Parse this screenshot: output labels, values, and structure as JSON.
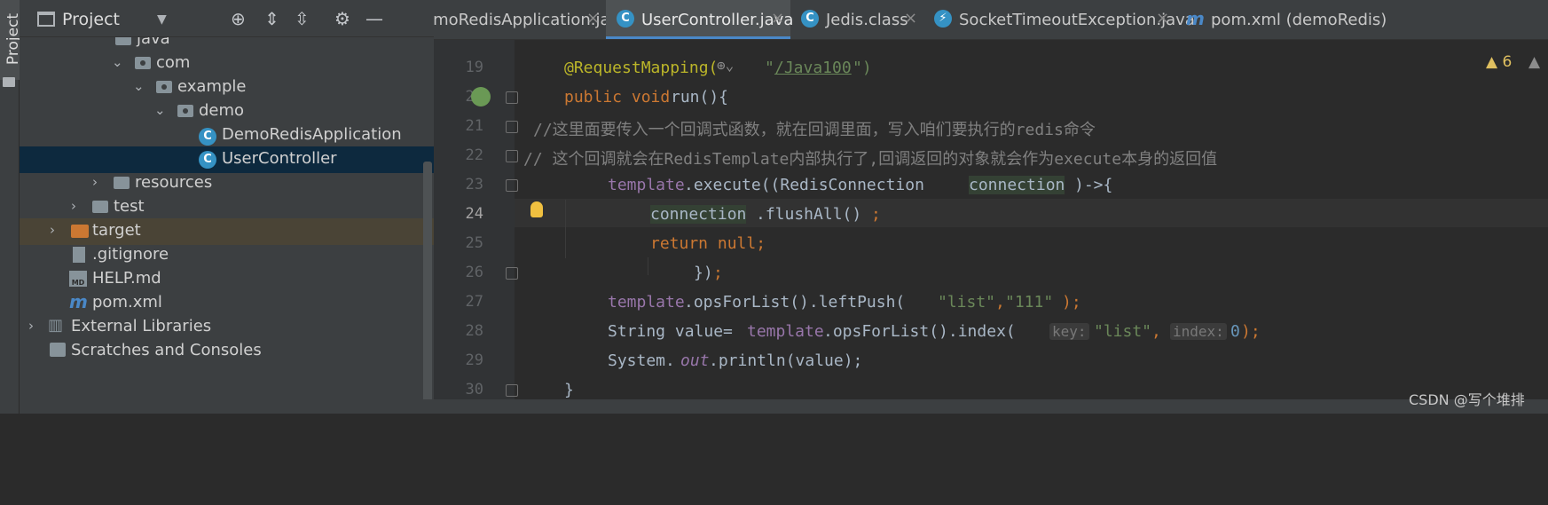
{
  "side_strip": {
    "label": "Project"
  },
  "project_panel": {
    "title": "Project",
    "tree": [
      {
        "label": "java",
        "level": 5,
        "kind": "folder",
        "expanded": true
      },
      {
        "label": "com",
        "level": 5,
        "kind": "package",
        "expanded": true
      },
      {
        "label": "example",
        "level": 6,
        "kind": "package",
        "expanded": true
      },
      {
        "label": "demo",
        "level": 7,
        "kind": "package",
        "expanded": true
      },
      {
        "label": "DemoRedisApplication",
        "level": 8,
        "kind": "spring-class"
      },
      {
        "label": "UserController",
        "level": 8,
        "kind": "class",
        "selected": true
      },
      {
        "label": "resources",
        "level": 4,
        "kind": "folder",
        "expanded": false
      },
      {
        "label": "test",
        "level": 3,
        "kind": "folder",
        "expanded": false
      },
      {
        "label": "target",
        "level": 2,
        "kind": "excluded-folder",
        "expanded": false
      },
      {
        "label": ".gitignore",
        "level": 2,
        "kind": "file"
      },
      {
        "label": "HELP.md",
        "level": 2,
        "kind": "md-file"
      },
      {
        "label": "pom.xml",
        "level": 2,
        "kind": "maven-file"
      },
      {
        "label": "External Libraries",
        "level": 1,
        "kind": "libraries",
        "expanded": false
      },
      {
        "label": "Scratches and Consoles",
        "level": 1,
        "kind": "scratches"
      }
    ]
  },
  "tabs": [
    {
      "label": "emoRedisApplication.java",
      "icon": "spring-class-icon",
      "active": false
    },
    {
      "label": "UserController.java",
      "icon": "class-icon",
      "active": true
    },
    {
      "label": "Jedis.class",
      "icon": "class-icon",
      "active": false
    },
    {
      "label": "SocketTimeoutException.java",
      "icon": "exception-class-icon",
      "active": false
    },
    {
      "label": "pom.xml (demoRedis)",
      "icon": "maven-icon",
      "active": false
    }
  ],
  "editor": {
    "warnings_count": "6",
    "lines": [
      {
        "num": "19",
        "text": "@RequestMapping(\"/Java100\")"
      },
      {
        "num": "20",
        "text": "public void run(){"
      },
      {
        "num": "21",
        "text": "//这里面要传入一个回调式函数，就在回调里面，写入咱们要执行的redis命令"
      },
      {
        "num": "22",
        "text": "// 这个回调就会在RedisTemplate内部执行了,回调返回的对象就会作为execute本身的返回值"
      },
      {
        "num": "23",
        "text": "template.execute((RedisConnection connection)->{"
      },
      {
        "num": "24",
        "text": "connection.flushAll();"
      },
      {
        "num": "25",
        "text": "return null;"
      },
      {
        "num": "26",
        "text": "});"
      },
      {
        "num": "27",
        "text": "template.opsForList().leftPush(\"list\",\"111\");"
      },
      {
        "num": "28",
        "text": "String value=template.opsForList().index( key: \"list\", index: 0);"
      },
      {
        "num": "29",
        "text": "System.out.println(value);"
      },
      {
        "num": "30",
        "text": "}"
      }
    ],
    "tokens": {
      "annotation": "@RequestMapping(",
      "path_open_quote": "\"",
      "path": "/Java100",
      "path_close": "\")",
      "kw_public_void": "public void ",
      "run": "run(){",
      "comment1": "//这里面要传入一个回调式函数，就在回调里面，写入咱们要执行的redis命令",
      "comment2": "// 这个回调就会在RedisTemplate内部执行了,回调返回的对象就会作为execute本身的返回值",
      "template": "template",
      "execute": ".execute((RedisConnection ",
      "connection": "connection",
      "arrow": ")->{",
      "flush_obj": "connection",
      "flush_call": ".flushAll()",
      "semi": ";",
      "return_null": "return null;",
      "close_lambda": "})",
      "leftpush": ".opsForList().leftPush(",
      "list_str": "\"list\"",
      "comma": ",",
      "str_111": "\"111\"",
      "close_paren_semi": ");",
      "string_value": "String value=",
      "index_call": ".opsForList().index(",
      "hint_key": "key:",
      "hint_index": "index:",
      "zero": "0",
      "system": "System.",
      "out": "out",
      "println": ".println(value);",
      "brace": "}"
    }
  },
  "watermark": "CSDN @写个堆排"
}
